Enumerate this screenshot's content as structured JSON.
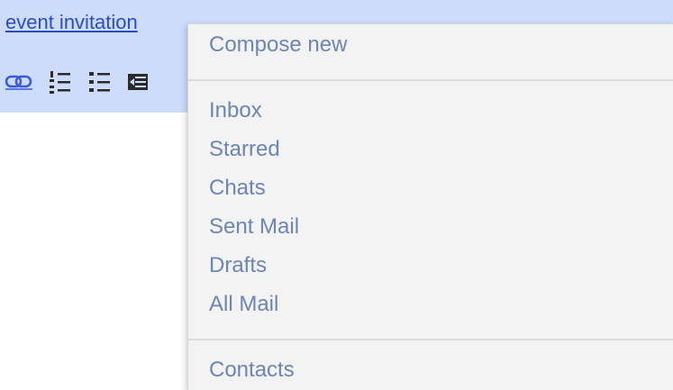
{
  "compose": {
    "subject_link": "event invitation",
    "toolbar_icons": [
      "link-icon",
      "numbered-list-icon",
      "bulleted-list-icon",
      "indent-less-icon"
    ]
  },
  "menu": {
    "compose_new": "Compose new",
    "items": [
      "Inbox",
      "Starred",
      "Chats",
      "Sent Mail",
      "Drafts",
      "All Mail"
    ],
    "contacts": "Contacts"
  },
  "colors": {
    "compose_bar": "#cddcfb",
    "link": "#2a4cc7",
    "menu_bg": "#f3f3f3",
    "menu_text": "#6c86b3"
  }
}
